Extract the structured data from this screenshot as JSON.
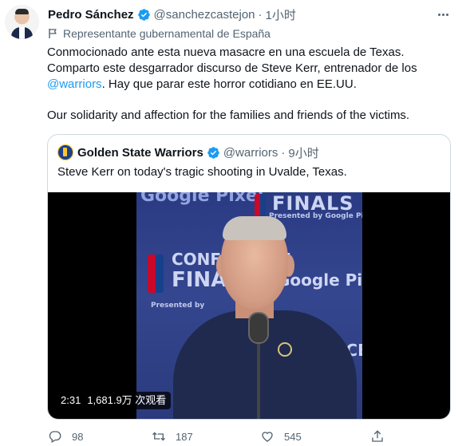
{
  "author": {
    "name": "Pedro Sánchez",
    "handle": "@sanchezcastejon",
    "separator": "·",
    "time": "1小时",
    "label": "Representante gubernamental de España"
  },
  "body": {
    "line1": "Conmocionado ante esta nueva masacre en una escuela de Texas.",
    "line2": "Comparto este desgarrador discurso de Steve Kerr, entrenador de los",
    "mention": "@warriors",
    "line3_rest": ". Hay que parar este horror cotidiano en EE.UU.",
    "line4": "Our solidarity and affection for the families and friends of the victims."
  },
  "quote": {
    "name": "Golden State Warriors",
    "handle": "@warriors",
    "separator": "·",
    "time": "9小时",
    "text": "Steve Kerr on today's tragic shooting in Uvalde, Texas.",
    "video": {
      "duration": "2:31",
      "views": "1,681.9万 次观看",
      "backdrop": {
        "t1": "Google Pixel",
        "t2": "FINALS",
        "t3": "Presented by Google Pixel",
        "t4": "CONFERENCE",
        "t5": "FINALS",
        "t6": "Google Pixel",
        "t7": "Presented by",
        "t8": "ENCE"
      }
    }
  },
  "actions": {
    "reply_count": "98",
    "retweet_count": "187",
    "like_count": "545",
    "icons": [
      "reply-icon",
      "retweet-icon",
      "like-icon",
      "share-icon"
    ]
  },
  "colors": {
    "accent": "#1d9bf0",
    "text": "#0f1419",
    "muted": "#536471",
    "border": "#cfd9de"
  }
}
